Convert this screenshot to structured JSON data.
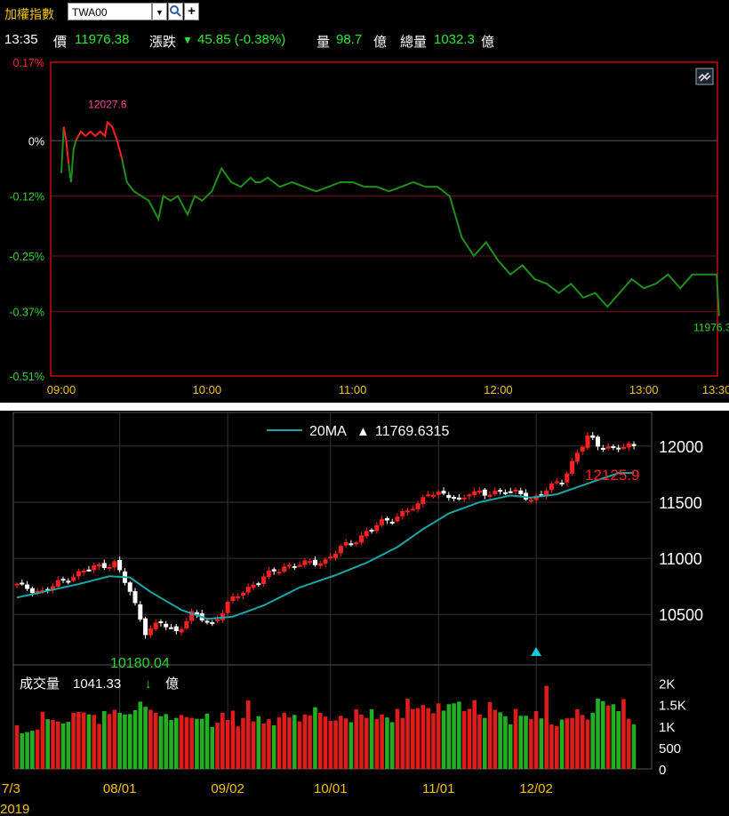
{
  "header": {
    "title": "加權指數",
    "symbol": "TWA00",
    "dropdown_icon": "▼",
    "search_icon": "magnifier",
    "add_icon": "+"
  },
  "quote": {
    "time": "13:35",
    "price_label": "價",
    "price": "11976.38",
    "change_label": "漲跌",
    "change_arrow": "▼",
    "change": "45.85 (-0.38%)",
    "volume_label": "量",
    "volume": "98.7",
    "volume_unit": "億",
    "total_label": "總量",
    "total": "1032.3",
    "total_unit": "億"
  },
  "colors": {
    "up": "#ff2020",
    "down": "#2fd12f",
    "ma": "#1aa6a6",
    "frame": "#cc0000",
    "intraday_line": "#1e8f1e",
    "accent": "#f2c200"
  },
  "chart_data": [
    {
      "type": "line",
      "x_ticks": [
        "09:00",
        "10:00",
        "11:00",
        "12:00",
        "13:00",
        "13:30"
      ],
      "y_ticks": [
        "0.17%",
        "0%",
        "-0.12%",
        "-0.25%",
        "-0.37%",
        "-0.51%"
      ],
      "ylim_pct": [
        -0.51,
        0.17
      ],
      "reference": 0,
      "high_label": "12027.6",
      "last_label": "11976.3",
      "link_icon": "link-icon",
      "series": [
        {
          "x_minutes": [
            0,
            1,
            2,
            3,
            4,
            5,
            6,
            8,
            10,
            12,
            14,
            16,
            18,
            19,
            21,
            23,
            25,
            27,
            30,
            33,
            36,
            38,
            40,
            42,
            45,
            48,
            52,
            55,
            58,
            62,
            66,
            70,
            74,
            78,
            80,
            82,
            85,
            90,
            95,
            100,
            105,
            110,
            115,
            120,
            125,
            130,
            135,
            140,
            145,
            150,
            155,
            160,
            165,
            170,
            175,
            180,
            185,
            190,
            195,
            200,
            205,
            210,
            215,
            220,
            225,
            230,
            235,
            240,
            245,
            250,
            255,
            260,
            265,
            270,
            271
          ],
          "values_pct": [
            -0.07,
            0.03,
            0.0,
            -0.05,
            -0.09,
            -0.02,
            0.0,
            0.02,
            0.01,
            0.02,
            0.01,
            0.02,
            0.01,
            0.04,
            0.03,
            0.0,
            -0.04,
            -0.09,
            -0.11,
            -0.12,
            -0.13,
            -0.15,
            -0.17,
            -0.12,
            -0.13,
            -0.12,
            -0.16,
            -0.12,
            -0.13,
            -0.11,
            -0.06,
            -0.09,
            -0.1,
            -0.08,
            -0.09,
            -0.09,
            -0.08,
            -0.1,
            -0.09,
            -0.1,
            -0.11,
            -0.1,
            -0.09,
            -0.09,
            -0.1,
            -0.1,
            -0.11,
            -0.1,
            -0.09,
            -0.1,
            -0.1,
            -0.12,
            -0.21,
            -0.25,
            -0.22,
            -0.26,
            -0.29,
            -0.27,
            -0.3,
            -0.31,
            -0.33,
            -0.31,
            -0.34,
            -0.33,
            -0.36,
            -0.33,
            -0.3,
            -0.32,
            -0.31,
            -0.29,
            -0.32,
            -0.29,
            -0.29,
            -0.29,
            -0.38
          ]
        }
      ]
    },
    {
      "type": "candlestick",
      "legend": "20MA",
      "legend_arrow": "▲",
      "legend_value": "11769.6315",
      "y_ticks": [
        12000,
        11500,
        11000,
        10500
      ],
      "ylim": [
        10050,
        12300
      ],
      "max_label": "12125.9",
      "min_label": "10180.04",
      "x_ticks": [
        "7/3",
        "08/01",
        "09/02",
        "10/01",
        "11/01",
        "12/02"
      ],
      "year": "2019",
      "volume_label": "成交量",
      "volume_value": "1041.33",
      "volume_arrow": "↓",
      "volume_unit": "億",
      "volume_ticks": [
        "2K",
        "1.5K",
        "1K",
        "500",
        "0"
      ],
      "volume_ylim": [
        0,
        2200
      ],
      "price_anchors": [
        [
          0,
          10760
        ],
        [
          5,
          10700
        ],
        [
          10,
          10830
        ],
        [
          15,
          10920
        ],
        [
          19,
          10960
        ],
        [
          22,
          10700
        ],
        [
          25,
          10350
        ],
        [
          28,
          10420
        ],
        [
          31,
          10350
        ],
        [
          34,
          10500
        ],
        [
          38,
          10420
        ],
        [
          41,
          10590
        ],
        [
          44,
          10710
        ],
        [
          48,
          10830
        ],
        [
          52,
          10930
        ],
        [
          56,
          10950
        ],
        [
          60,
          10980
        ],
        [
          63,
          11090
        ],
        [
          67,
          11200
        ],
        [
          71,
          11320
        ],
        [
          75,
          11400
        ],
        [
          78,
          11470
        ],
        [
          80,
          11600
        ],
        [
          83,
          11560
        ],
        [
          86,
          11520
        ],
        [
          88,
          11600
        ],
        [
          91,
          11560
        ],
        [
          95,
          11620
        ],
        [
          97,
          11580
        ],
        [
          100,
          11520
        ],
        [
          103,
          11620
        ],
        [
          106,
          11680
        ],
        [
          109,
          11950
        ],
        [
          111,
          12080
        ],
        [
          113,
          12000
        ],
        [
          117,
          11990
        ]
      ],
      "ma_anchors": [
        [
          0,
          10650
        ],
        [
          6,
          10710
        ],
        [
          12,
          10770
        ],
        [
          18,
          10840
        ],
        [
          22,
          10830
        ],
        [
          26,
          10700
        ],
        [
          32,
          10540
        ],
        [
          37,
          10460
        ],
        [
          42,
          10480
        ],
        [
          48,
          10580
        ],
        [
          55,
          10740
        ],
        [
          62,
          10850
        ],
        [
          68,
          10960
        ],
        [
          74,
          11100
        ],
        [
          79,
          11260
        ],
        [
          84,
          11400
        ],
        [
          90,
          11500
        ],
        [
          96,
          11560
        ],
        [
          100,
          11540
        ],
        [
          105,
          11570
        ],
        [
          110,
          11650
        ],
        [
          117,
          11760
        ]
      ],
      "volume_bars": [
        1020,
        830,
        860,
        890,
        920,
        1330,
        1160,
        1140,
        1110,
        1060,
        1100,
        1310,
        1330,
        1320,
        1270,
        1260,
        1050,
        1350,
        1280,
        1380,
        1310,
        1270,
        1280,
        1370,
        1570,
        1450,
        1380,
        1310,
        1230,
        1280,
        1140,
        1190,
        1260,
        1210,
        1190,
        1170,
        1170,
        1290,
        980,
        1080,
        1310,
        1140,
        1360,
        990,
        1190,
        1600,
        1110,
        1230,
        1060,
        1160,
        1020,
        1200,
        1310,
        1200,
        1260,
        1110,
        1270,
        1250,
        1440,
        1310,
        1220,
        1120,
        1130,
        1240,
        1180,
        1090,
        1390,
        1270,
        1190,
        1390,
        1160,
        1270,
        1200,
        1090,
        1400,
        1190,
        1640,
        1400,
        1420,
        1490,
        1420,
        1300,
        1530,
        1360,
        1510,
        1530,
        1570,
        1350,
        1400,
        1600,
        1270,
        1190,
        1560,
        1380,
        1320,
        1230,
        1040,
        1400,
        1240,
        1240,
        1160,
        1350,
        1180,
        1940,
        1040,
        1000,
        1150,
        1180,
        1190,
        1390,
        1260,
        1150,
        1310,
        1640,
        1580,
        1480,
        1510,
        1350,
        1630,
        1170,
        1040
      ]
    }
  ]
}
